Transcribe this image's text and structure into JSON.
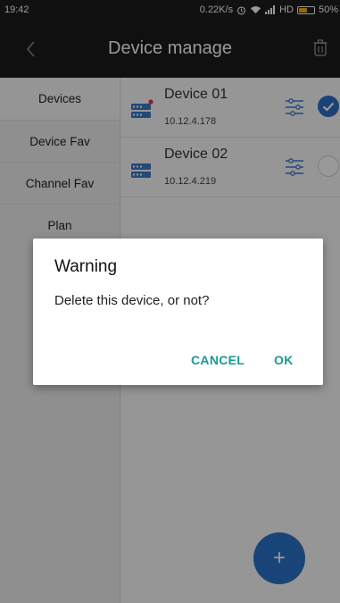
{
  "status_bar": {
    "time": "19:42",
    "speed": "0.22K/s",
    "network": "HD",
    "battery": "50%",
    "icons": [
      "alarm-icon",
      "wifi-icon",
      "signal-icon",
      "battery-icon"
    ]
  },
  "app_bar": {
    "title": "Device manage",
    "back_icon": "chevron-left-icon",
    "action_icon": "trash-icon"
  },
  "sidebar": {
    "items": [
      {
        "label": "Devices",
        "active": true
      },
      {
        "label": "Device Fav",
        "active": false
      },
      {
        "label": "Channel Fav",
        "active": false
      },
      {
        "label": "Plan",
        "active": false
      }
    ]
  },
  "devices": [
    {
      "name": "Device 01",
      "ip": "10.12.4.178",
      "selected": true
    },
    {
      "name": "Device 02",
      "ip": "10.12.4.219",
      "selected": false
    }
  ],
  "fab": {
    "label": "+"
  },
  "dialog": {
    "title": "Warning",
    "message": "Delete this device, or not?",
    "cancel_label": "CANCEL",
    "ok_label": "OK"
  },
  "colors": {
    "accent": "#1a9b93",
    "primary": "#2a72c9",
    "app_bar": "#1b1b1b",
    "battery": "#f5b300",
    "alert_dot": "#e53935"
  }
}
